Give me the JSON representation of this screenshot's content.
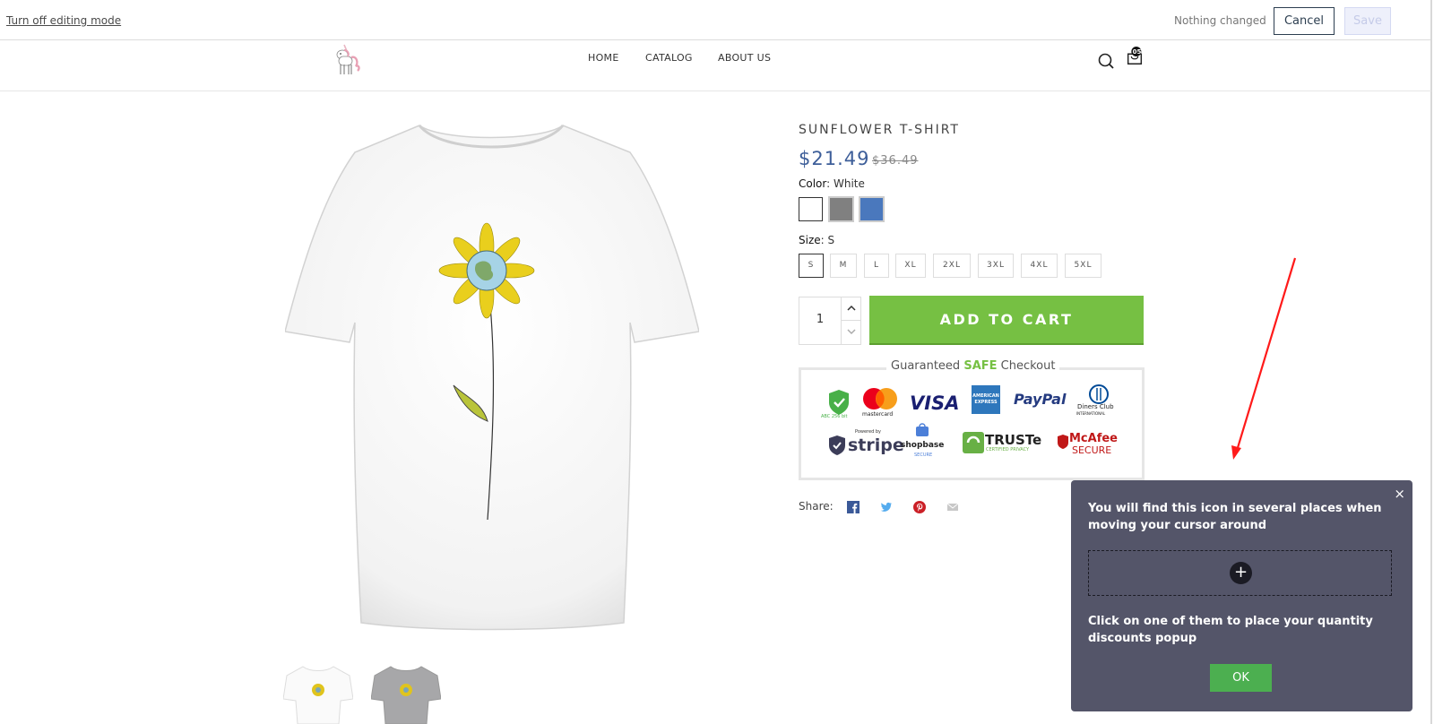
{
  "editbar": {
    "turn_off_label": "Turn off editing mode",
    "status_text": "Nothing changed",
    "cancel_label": "Cancel",
    "save_label": "Save"
  },
  "header": {
    "nav": [
      "HOME",
      "CATALOG",
      "ABOUT US"
    ],
    "cart_count": "05",
    "icons": [
      "unicorn-logo",
      "search-icon",
      "cart-icon"
    ]
  },
  "product": {
    "title": "SUNFLOWER T-SHIRT",
    "price": "$21.49",
    "old_price": "$36.49",
    "color_label": "Color",
    "color_value": "White",
    "colors": [
      "#ffffff",
      "#808080",
      "#4a78bd"
    ],
    "size_label": "Size",
    "size_value": "S",
    "sizes": [
      "S",
      "M",
      "L",
      "XL",
      "2XL",
      "3XL",
      "4XL",
      "5XL"
    ],
    "quantity": "1",
    "add_to_cart": "ADD TO CART"
  },
  "trust": {
    "title_pre": "Guaranteed",
    "title_safe": "SAFE",
    "title_post": "Checkout",
    "badges_row1": [
      "secure-shield",
      "mastercard",
      "VISA",
      "AMERICAN EXPRESS",
      "PayPal",
      "Diners Club"
    ],
    "badges_row2": [
      "stripe",
      "shopbase",
      "TRUSTe",
      "McAfee SECURE"
    ],
    "badge_texts": {
      "shield": "ABC 256 bit",
      "mastercard": "mastercard",
      "visa": "VISA",
      "amex": "AMERICAN EXPRESS",
      "paypal": "PayPal",
      "diners": "Diners Club",
      "diners_sub": "INTERNATIONAL",
      "stripe_small": "Powered by",
      "stripe": "stripe",
      "shopbase": "shopbase",
      "shopbase_sub": "SECURE",
      "truste": "TRUSTe",
      "truste_sub": "CERTIFIED PRIVACY",
      "mcafee": "McAfee",
      "mcafee_sub": "SECURE"
    }
  },
  "share": {
    "label": "Share:",
    "icons": [
      "facebook-icon",
      "twitter-icon",
      "pinterest-icon",
      "email-icon"
    ]
  },
  "popup": {
    "message1": "You will find this icon in several places when moving your cursor around",
    "message2": "Click on one of them to place your quantity discounts popup",
    "ok_label": "OK",
    "close_glyph": "×",
    "plus_glyph": "+"
  },
  "colors": {
    "accent_green": "#76c043",
    "price_blue": "#3d5e99",
    "popup_bg": "#545569",
    "arrow_red": "#ff1a1a"
  }
}
